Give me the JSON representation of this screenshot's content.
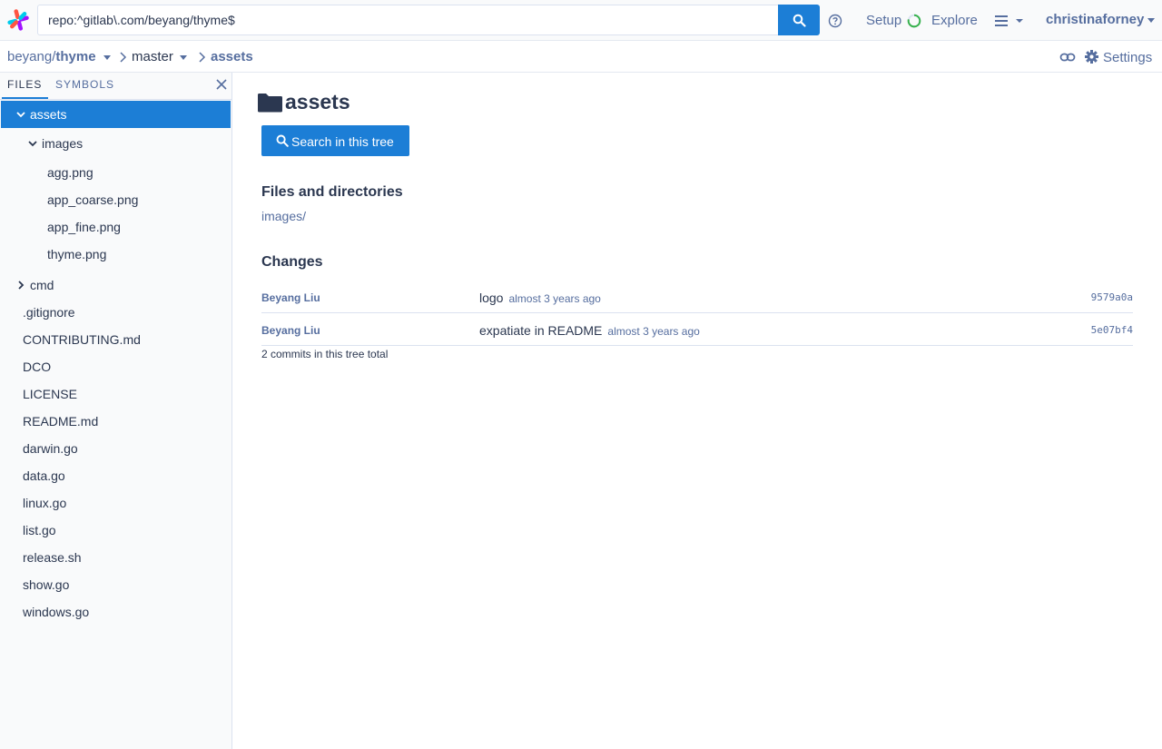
{
  "search": {
    "query": "repo:^gitlab\\.com/beyang/thyme$"
  },
  "nav": {
    "setup": "Setup",
    "explore": "Explore",
    "user": "christinaforney"
  },
  "breadcrumb": {
    "owner": "beyang/",
    "repo": "thyme",
    "branch": "master",
    "current": "assets"
  },
  "actions": {
    "settings": "Settings"
  },
  "sidebar": {
    "tabs": [
      "FILES",
      "SYMBOLS"
    ],
    "tree": [
      {
        "label": "assets",
        "expanded": true,
        "selected": true
      },
      {
        "label": "images",
        "expanded": true
      },
      {
        "label": "agg.png"
      },
      {
        "label": "app_coarse.png"
      },
      {
        "label": "app_fine.png"
      },
      {
        "label": "thyme.png"
      },
      {
        "label": "cmd",
        "expanded": false
      },
      {
        "label": ".gitignore"
      },
      {
        "label": "CONTRIBUTING.md"
      },
      {
        "label": "DCO"
      },
      {
        "label": "LICENSE"
      },
      {
        "label": "README.md"
      },
      {
        "label": "darwin.go"
      },
      {
        "label": "data.go"
      },
      {
        "label": "linux.go"
      },
      {
        "label": "list.go"
      },
      {
        "label": "release.sh"
      },
      {
        "label": "show.go"
      },
      {
        "label": "windows.go"
      }
    ]
  },
  "main": {
    "title": "assets",
    "search_tree_button": "Search in this tree",
    "files_heading": "Files and directories",
    "entries": [
      "images/"
    ],
    "changes_heading": "Changes",
    "commits": [
      {
        "author": "Beyang Liu",
        "message": "logo",
        "age": "almost 3 years ago",
        "sha": "9579a0a"
      },
      {
        "author": "Beyang Liu",
        "message": "expatiate in README",
        "age": "almost 3 years ago",
        "sha": "5e07bf4"
      }
    ],
    "commit_total": "2 commits in this tree total"
  },
  "colors": {
    "accent": "#1c7ed6",
    "link": "#566e9f",
    "text": "#2b3750"
  }
}
